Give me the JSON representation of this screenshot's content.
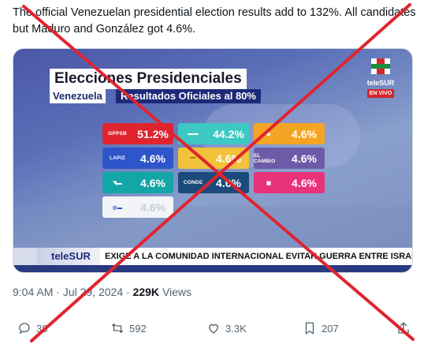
{
  "tweet": {
    "text": "The official Venezuelan presidential election results add to 132%. All candidates but Maduro and González got 4.6%."
  },
  "broadcast": {
    "title": "Elecciones Presidenciales",
    "subtitle_country": "Venezuela",
    "subtitle_results": "Resultados Oficiales al 80%",
    "channel_name": "teleSUR",
    "live_badge": "EN VIVO",
    "ticker_brand": "teleSUR",
    "ticker_text": "EXIGE A LA COMUNIDAD INTERNACIONAL EVITAR GUERRA ENTRE ISRAEL Y EL LÍBA",
    "results": [
      {
        "logo": "GPPSB",
        "pct": "51.2%",
        "color": "#e0242f"
      },
      {
        "logo": "",
        "pct": "44.2%",
        "color": "#3dc8c4"
      },
      {
        "logo": "",
        "pct": "4.6%",
        "color": "#f5a524"
      },
      {
        "logo": "LAPIZ",
        "pct": "4.6%",
        "color": "#2e55c9"
      },
      {
        "logo": "",
        "pct": "4.6%",
        "color": "#f2c23a"
      },
      {
        "logo": "EL CAMBIO",
        "pct": "4.6%",
        "color": "#6d5aa8"
      },
      {
        "logo": "",
        "pct": "4.6%",
        "color": "#12a7a6"
      },
      {
        "logo": "CONDE",
        "pct": "4.6%",
        "color": "#1c4a7a"
      },
      {
        "logo": "",
        "pct": "4.6%",
        "color": "#e8327a"
      },
      {
        "logo": "",
        "pct": "4.6%",
        "color": "#f3f4f8"
      }
    ]
  },
  "meta": {
    "time": "9:04 AM",
    "date": "Jul 29, 2024",
    "views_count": "229K",
    "views_label": "Views"
  },
  "actions": {
    "replies": "38",
    "reposts": "592",
    "likes": "3.3K",
    "bookmarks": "207"
  },
  "colors": {
    "cross": "#e0242f",
    "icon": "#536471"
  }
}
